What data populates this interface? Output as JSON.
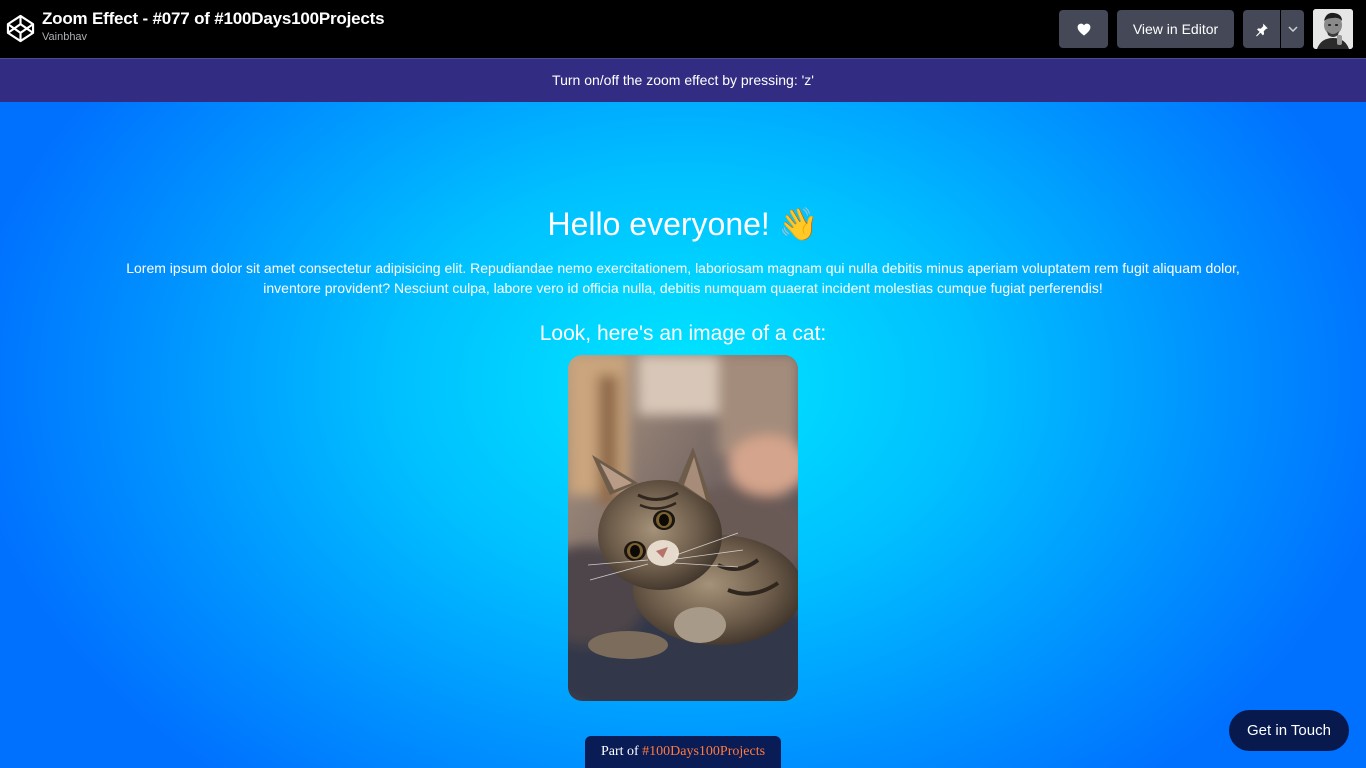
{
  "header": {
    "title": "Zoom Effect - #077 of #100Days100Projects",
    "author": "Vainbhav",
    "view_in_editor_label": "View in Editor",
    "logo_icon": "codepen-logo-icon",
    "heart_icon": "heart-icon",
    "pin_icon": "pin-icon",
    "dropdown_icon": "chevron-down-icon"
  },
  "notice": {
    "text": "Turn on/off the zoom effect by pressing: 'z'"
  },
  "main": {
    "heading": "Hello everyone! 👋",
    "paragraph": "Lorem ipsum dolor sit amet consectetur adipisicing elit. Repudiandae nemo exercitationem, laboriosam magnam qui nulla debitis minus aperiam voluptatem rem fugit aliquam dolor, inventore provident? Nesciunt culpa, labore vero id officia nulla, debitis numquam quaerat incident molestias cumque fugiat perferendis!",
    "subheading": "Look, here's an image of a cat:",
    "part_of_prefix": "Part of ",
    "part_of_tag": "#100Days100Projects",
    "get_in_touch_label": "Get in Touch"
  },
  "colors": {
    "header_bg": "#000000",
    "button_bg": "#444857",
    "notice_bg": "#322d82",
    "gradient_center": "#00e6ff",
    "gradient_edge": "#0070ff",
    "badge_bg": "#0a1c55",
    "tag_color": "#ff7a3d"
  }
}
